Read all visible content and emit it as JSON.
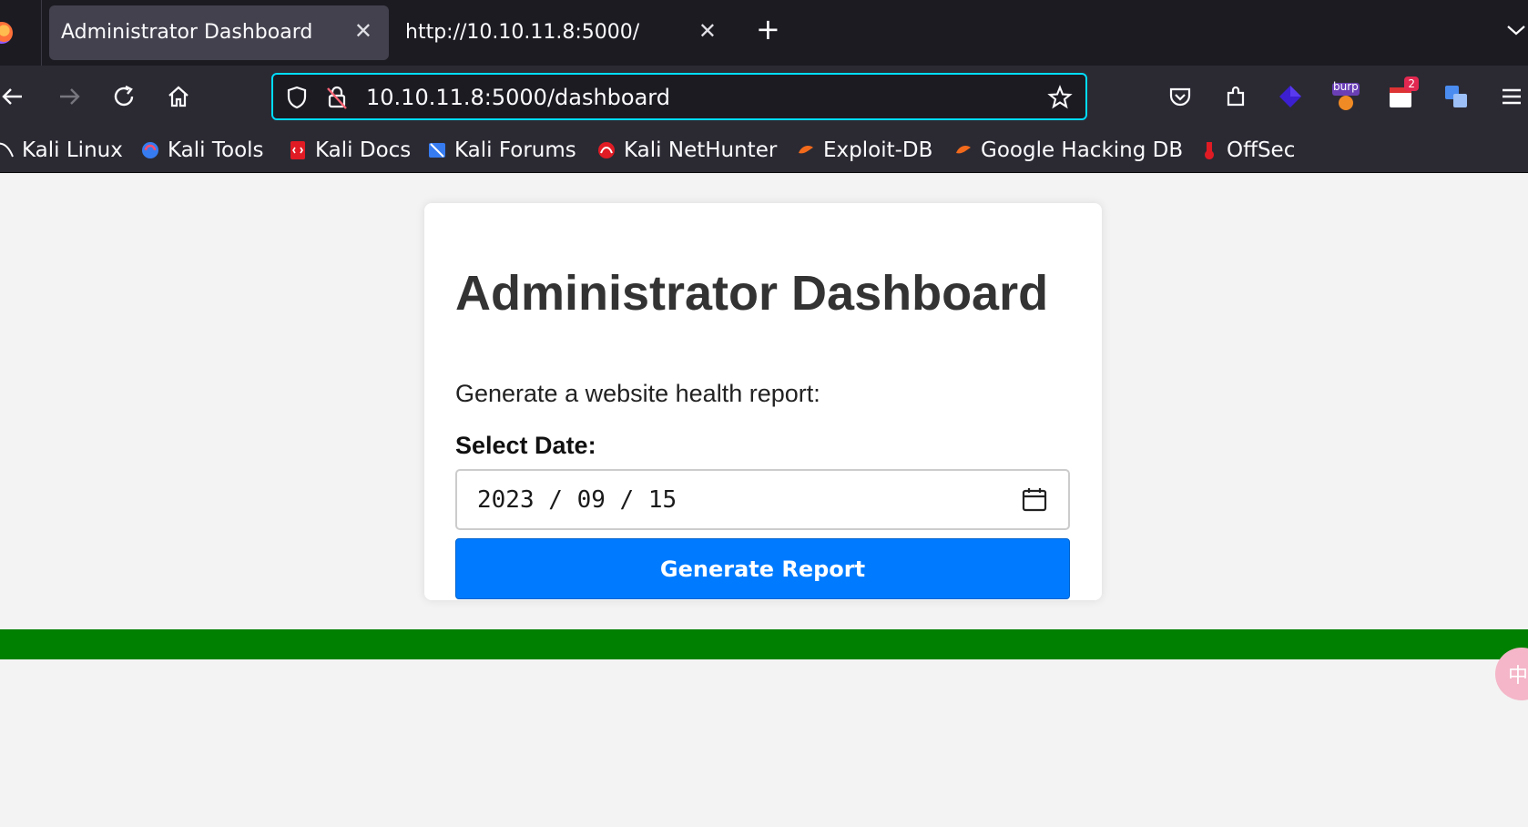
{
  "browser": {
    "tabs": [
      {
        "title": "Administrator Dashboard",
        "active": true
      },
      {
        "title": "http://10.10.11.8:5000/",
        "active": false
      }
    ],
    "url": "10.10.11.8:5000/dashboard",
    "extension_badge": "2",
    "burp_label": "burp",
    "bookmarks": [
      {
        "label": "Kali Linux",
        "icon": "kali-dragon-icon"
      },
      {
        "label": "Kali Tools",
        "icon": "kali-tools-icon"
      },
      {
        "label": "Kali Docs",
        "icon": "kali-docs-icon"
      },
      {
        "label": "Kali Forums",
        "icon": "kali-forums-icon"
      },
      {
        "label": "Kali NetHunter",
        "icon": "kali-nethunter-icon"
      },
      {
        "label": "Exploit-DB",
        "icon": "exploit-db-icon"
      },
      {
        "label": "Google Hacking DB",
        "icon": "ghdb-icon"
      },
      {
        "label": "OffSec",
        "icon": "offsec-icon"
      }
    ]
  },
  "page": {
    "title": "Administrator Dashboard",
    "description": "Generate a website health report:",
    "date_label": "Select Date:",
    "date_value": "2023 / 09 / 15",
    "button_label": "Generate Report",
    "float_glyph": "中"
  },
  "colors": {
    "primary_button": "#007bff",
    "status_bar": "#008000",
    "url_focus": "#00ddff"
  }
}
